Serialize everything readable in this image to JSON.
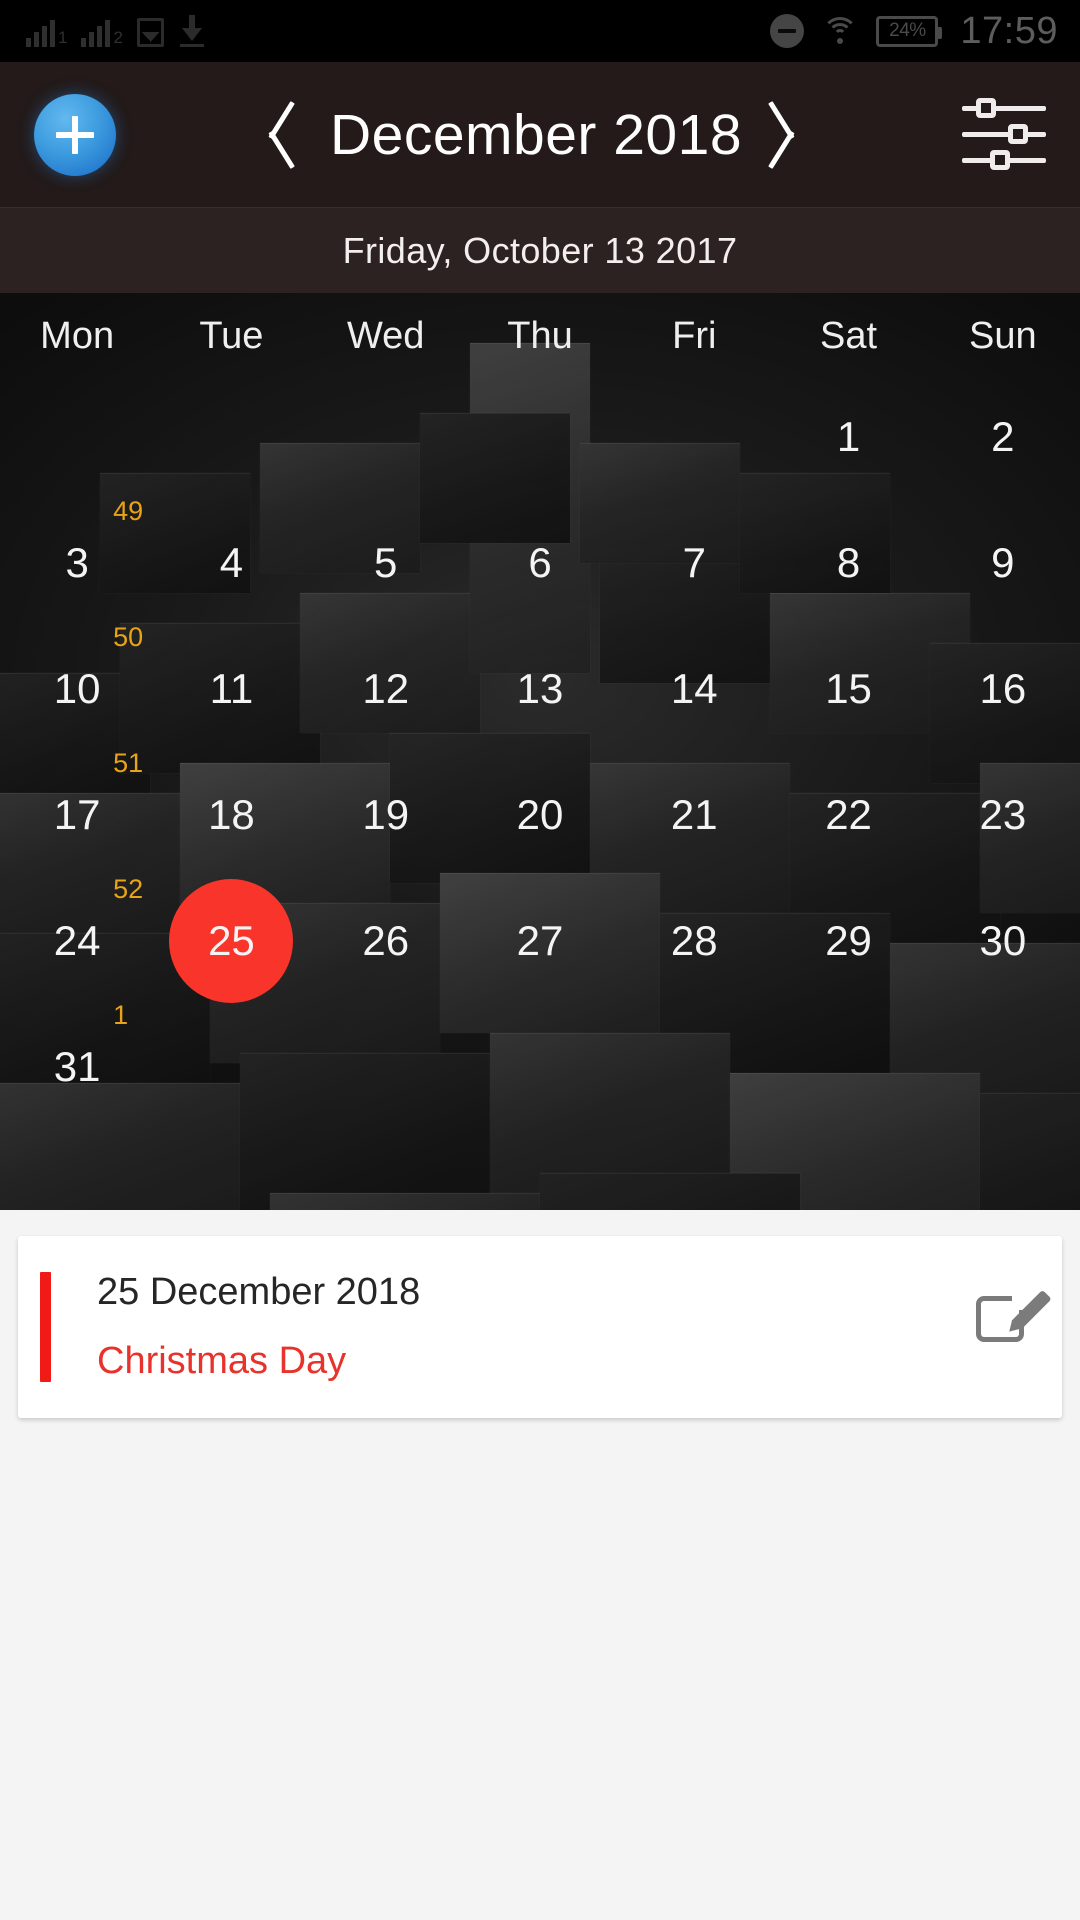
{
  "statusbar": {
    "sim1_label": "1",
    "sim2_label": "2",
    "photo_icon": "photo-icon",
    "download_icon": "download-icon",
    "dnd_icon": "do-not-disturb-icon",
    "wifi_icon": "wifi-icon",
    "battery_percent": "24%",
    "time": "17:59"
  },
  "appbar": {
    "add_label": "add-event",
    "prev_label": "previous-month",
    "next_label": "next-month",
    "month_year": "December  2018",
    "settings_label": "view-settings"
  },
  "subbar": {
    "today_text": "Friday, October 13  2017"
  },
  "calendar": {
    "weekday_headers": [
      "Mon",
      "Tue",
      "Wed",
      "Thu",
      "Fri",
      "Sat",
      "Sun"
    ],
    "selected_day": 25,
    "selected_color": "#f8342b",
    "weeknum_color": "#e8a317",
    "rows": [
      {
        "weeknum": "",
        "days": [
          "",
          "",
          "",
          "",
          "",
          "1",
          "2"
        ]
      },
      {
        "weeknum": "49",
        "days": [
          "3",
          "4",
          "5",
          "6",
          "7",
          "8",
          "9"
        ]
      },
      {
        "weeknum": "50",
        "days": [
          "10",
          "11",
          "12",
          "13",
          "14",
          "15",
          "16"
        ]
      },
      {
        "weeknum": "51",
        "days": [
          "17",
          "18",
          "19",
          "20",
          "21",
          "22",
          "23"
        ]
      },
      {
        "weeknum": "52",
        "days": [
          "24",
          "25",
          "26",
          "27",
          "28",
          "29",
          "30"
        ]
      },
      {
        "weeknum": "1",
        "days": [
          "31",
          "",
          "",
          "",
          "",
          "",
          ""
        ]
      }
    ]
  },
  "events": [
    {
      "date": "25 December 2018",
      "title": "Christmas Day",
      "accent_color": "#f21a16",
      "title_color": "#e8332c",
      "edit_label": "edit-event"
    }
  ]
}
